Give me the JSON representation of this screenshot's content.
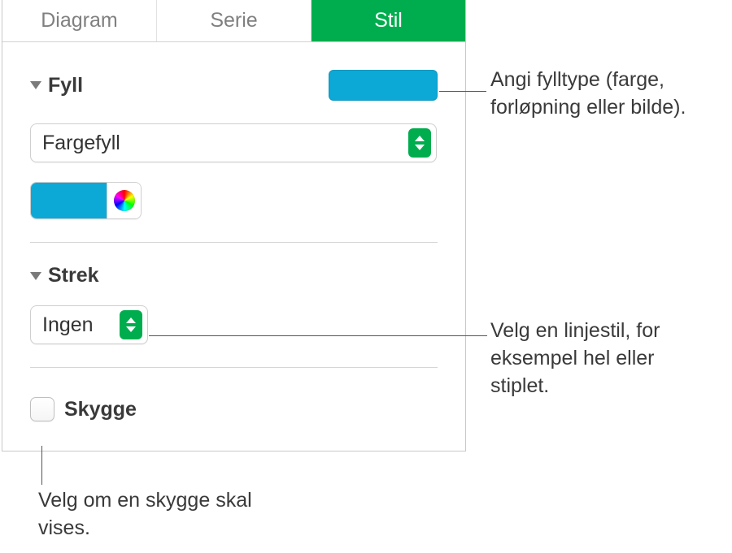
{
  "tabs": {
    "diagram": "Diagram",
    "serie": "Serie",
    "stil": "Stil"
  },
  "fill": {
    "title": "Fyll",
    "type": "Fargefyll",
    "color": "#0ca9d6"
  },
  "stroke": {
    "title": "Strek",
    "value": "Ingen"
  },
  "shadow": {
    "label": "Skygge"
  },
  "callouts": {
    "fill": "Angi fylltype (farge, forløpning eller bilde).",
    "stroke": "Velg en linjestil, for eksempel hel eller stiplet.",
    "shadow": "Velg om en skygge skal vises."
  }
}
